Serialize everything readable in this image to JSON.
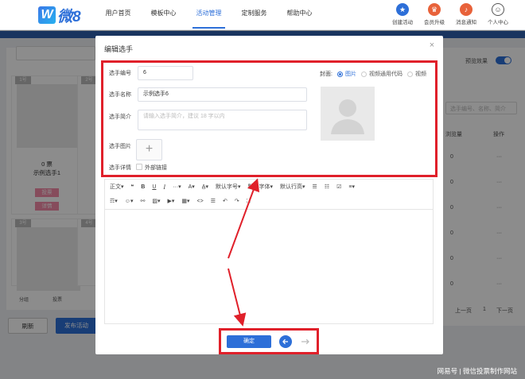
{
  "brand": {
    "logo_letter": "W",
    "logo_text": "微8"
  },
  "nav": {
    "items": [
      {
        "label": "用户首页"
      },
      {
        "label": "模板中心"
      },
      {
        "label": "活动管理",
        "active": true
      },
      {
        "label": "定制服务"
      },
      {
        "label": "帮助中心"
      }
    ]
  },
  "header_actions": [
    {
      "label": "创建活动",
      "icon": "star-icon",
      "color": "#2d6fd8"
    },
    {
      "label": "会员升级",
      "icon": "crown-icon",
      "color": "#e8623a"
    },
    {
      "label": "消息通知",
      "icon": "bell-icon",
      "color": "#e8623a"
    },
    {
      "label": "个人中心",
      "icon": "user-icon",
      "color": "#555555"
    }
  ],
  "background": {
    "cards": [
      {
        "badge": "1号",
        "votes": "0 票",
        "name": "示例选手1",
        "vote_btn": "投票",
        "detail_btn": "详情"
      },
      {
        "badge": "2号"
      },
      {
        "badge": "3号"
      },
      {
        "badge": "4号"
      }
    ],
    "tabbar": [
      "分组",
      "投票"
    ],
    "refresh_label": "刷新",
    "publish_label": "发布活动",
    "preview_label": "预览效果",
    "search_placeholder": "选手编号、名称、简介",
    "col_votes": "浏览量",
    "col_action": "操作",
    "row_values": [
      "0",
      "0",
      "0",
      "0",
      "0",
      "0"
    ],
    "row_more": "···",
    "pager_prev": "上一页",
    "pager_page": "1",
    "pager_next": "下一页"
  },
  "modal": {
    "title": "编辑选手",
    "close": "×",
    "fields": {
      "number_label": "选手编号",
      "number_value": "6",
      "name_label": "选手名称",
      "name_value": "示例选手6",
      "intro_label": "选手简介",
      "intro_placeholder": "请输入选手简介，建议 18 字以内",
      "image_label": "选手图片",
      "image_add": "+",
      "detail_label": "选手详情",
      "external_link_label": "外部链接"
    },
    "cover": {
      "label": "封面:",
      "options": [
        {
          "label": "图片",
          "selected": true
        },
        {
          "label": "视频通用代码",
          "selected": false
        },
        {
          "label": "视频",
          "selected": false
        }
      ]
    },
    "toolbar_row1": [
      "正文▾",
      "❝",
      "B",
      "U",
      "I",
      "···▾",
      "A▾",
      "A̲▾",
      "默认字号▾",
      "默认字体▾",
      "默认行高▾",
      "☰",
      "☷",
      "☑",
      "≡▾"
    ],
    "toolbar_row2": [
      "☶▾",
      "☺▾",
      "⚯",
      "▨▾",
      "▶▾",
      "▦▾",
      "<>",
      "☰",
      "↶",
      "↷",
      "⛶"
    ],
    "ok_label": "确定"
  },
  "watermark": "网易号 | 微信投票制作网站",
  "colors": {
    "primary": "#2d6fd8",
    "highlight": "#e0202a",
    "header_band": "#2f5fae"
  }
}
